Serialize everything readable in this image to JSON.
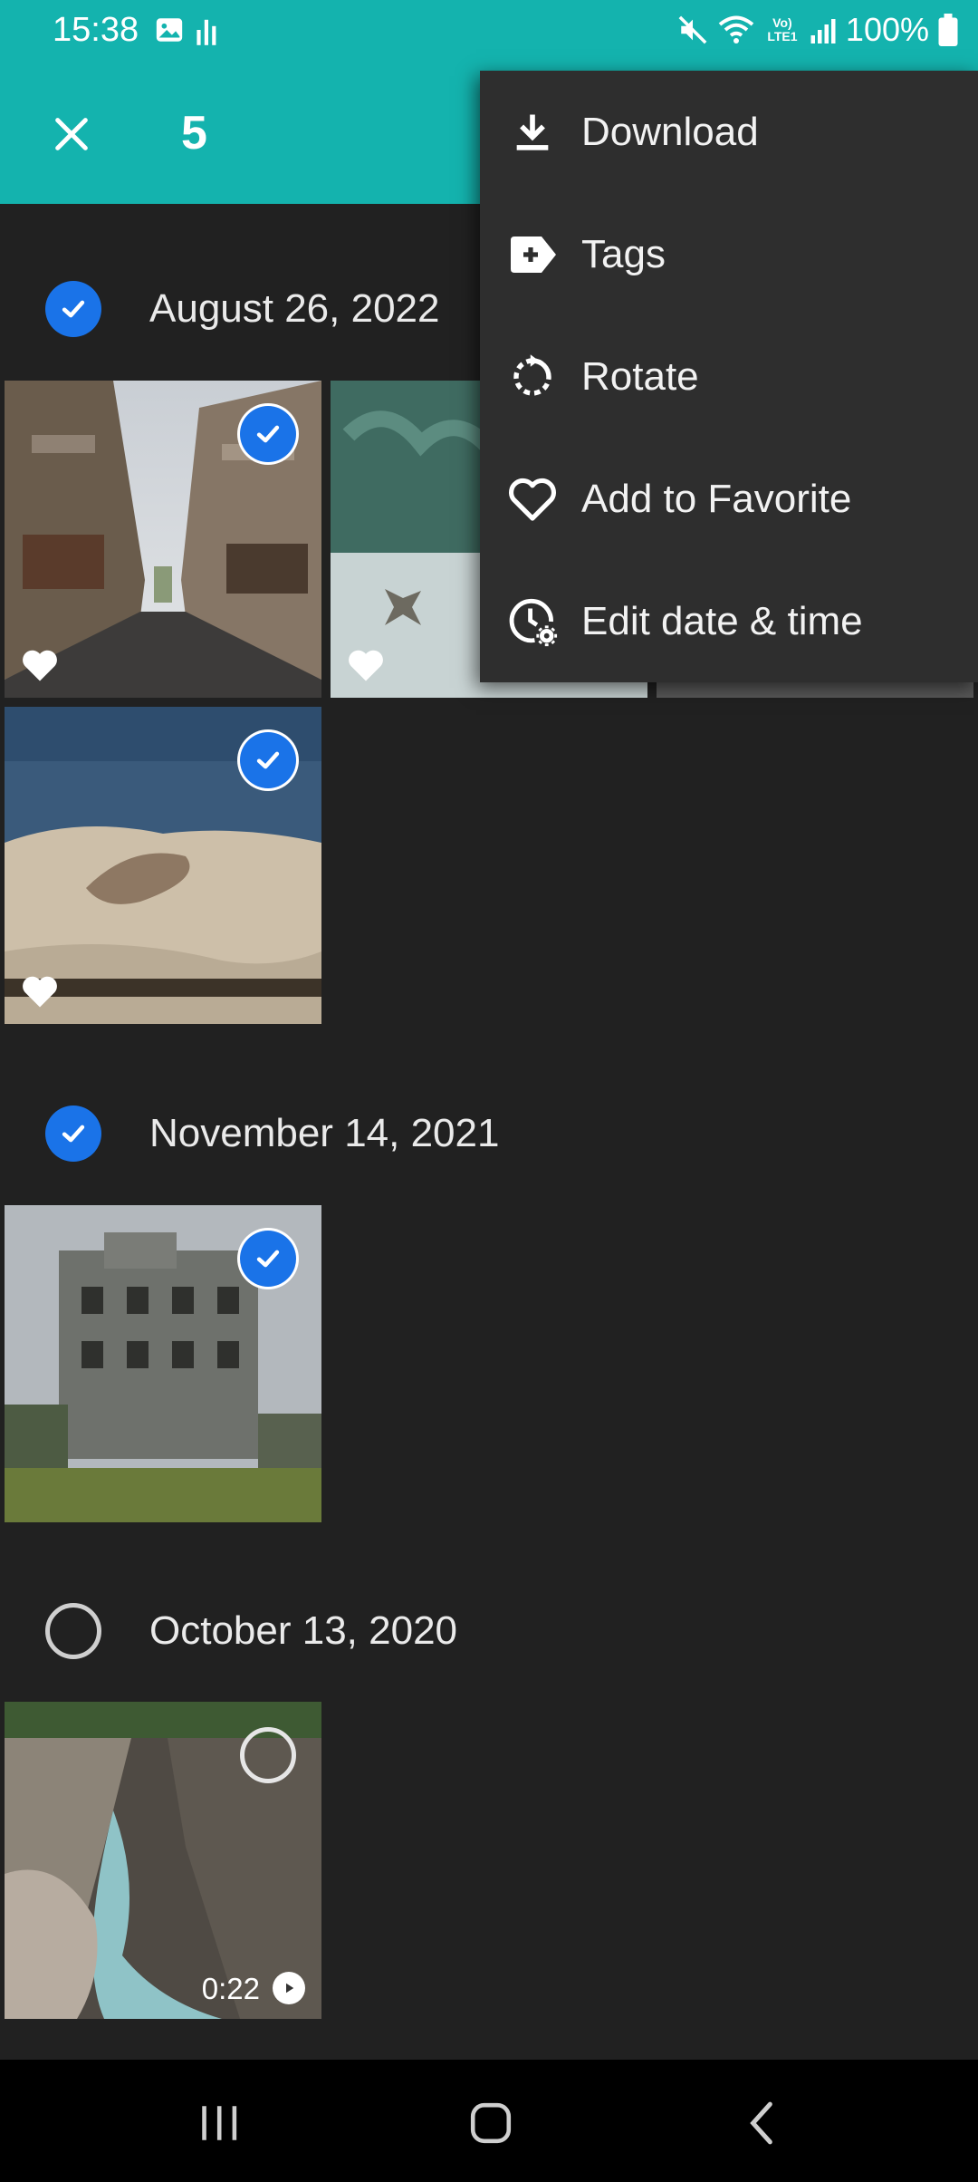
{
  "status_bar": {
    "time": "15:38",
    "battery": "100%",
    "network": "Vo) LTE1"
  },
  "app_bar": {
    "selected_count": "5"
  },
  "menu": {
    "items": [
      {
        "label": "Download",
        "icon": "download-icon"
      },
      {
        "label": "Tags",
        "icon": "tag-add-icon"
      },
      {
        "label": "Rotate",
        "icon": "rotate-icon"
      },
      {
        "label": "Add to Favorite",
        "icon": "heart-outline-icon"
      },
      {
        "label": "Edit date & time",
        "icon": "clock-gear-icon"
      }
    ]
  },
  "groups": [
    {
      "date": "August 26, 2022",
      "selected": true
    },
    {
      "date": "November 14, 2021",
      "selected": true
    },
    {
      "date": "October 13, 2020",
      "selected": false
    }
  ],
  "video": {
    "duration": "0:22"
  },
  "colors": {
    "accent": "#14b3ae",
    "selection": "#1a73e8",
    "background": "#212121",
    "menu": "#2e2e2e"
  }
}
